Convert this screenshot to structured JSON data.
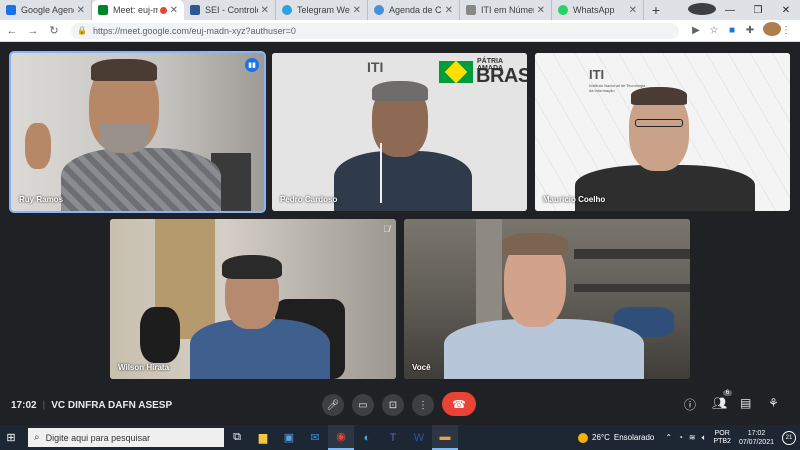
{
  "browser": {
    "tabs": [
      {
        "label": "Google Agenda",
        "color": "#1a73e8"
      },
      {
        "label": "Meet: euj-m",
        "color": "#00832d",
        "active": true
      },
      {
        "label": "SEI - Controle de",
        "color": "#2b5797"
      },
      {
        "label": "Telegram Web",
        "color": "#2aa3df"
      },
      {
        "label": "Agenda de Carlo",
        "color": "#4a90d9"
      },
      {
        "label": "ITI em Números",
        "color": "#888888"
      },
      {
        "label": "WhatsApp",
        "color": "#25d366"
      }
    ],
    "new_tab": "+",
    "url": "https://meet.google.com/euj-madn-xyz?authuser=0"
  },
  "meet": {
    "participants": [
      {
        "name": "Ruy Ramos"
      },
      {
        "name": "Pedro Cardoso"
      },
      {
        "name": "Maurício Coelho"
      },
      {
        "name": "Wilson Hirata"
      },
      {
        "name": "Você"
      }
    ],
    "backdrop_text": {
      "iti": "ITI",
      "patria": "PÁTRIA AMADA",
      "brasil": "BRASIL",
      "instituto": "Instituto Nacional de Tecnologia da Informação"
    },
    "time": "17:02",
    "separator": "|",
    "meeting_name": "VC DINFRA DAFN ASESP",
    "participants_count": "6"
  },
  "taskbar": {
    "search_placeholder": "Digite aqui para pesquisar",
    "temperature": "26°C",
    "weather": "Ensolarado",
    "lang_top": "POR",
    "lang_bottom": "PTB2",
    "clock_time": "17:02",
    "clock_date": "07/07/2021",
    "notifications": "21"
  },
  "colors": {
    "meet_bg": "#202124",
    "speaking_outline": "#8ab4f8",
    "hangup": "#ea4335",
    "taskbar": "#1c2733"
  }
}
